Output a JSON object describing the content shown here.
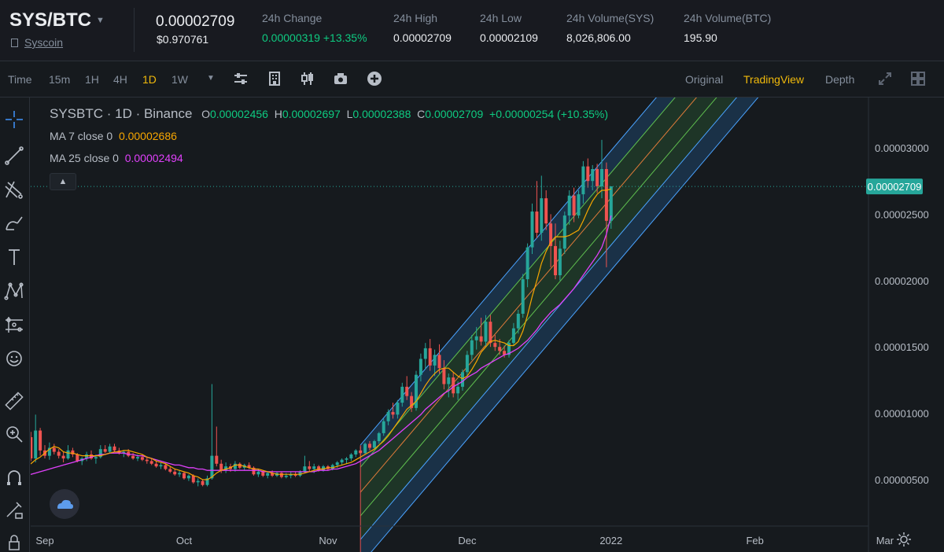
{
  "header": {
    "pair": "SYS/BTC",
    "coin_name": "Syscoin",
    "last_price": "0.00002709",
    "last_price_usd": "$0.970761",
    "stats": [
      {
        "label": "24h Change",
        "value": "0.00000319 +13.35%",
        "color": "green"
      },
      {
        "label": "24h High",
        "value": "0.00002709"
      },
      {
        "label": "24h Low",
        "value": "0.00002109"
      },
      {
        "label": "24h Volume(SYS)",
        "value": "8,026,806.00"
      },
      {
        "label": "24h Volume(BTC)",
        "value": "195.90"
      }
    ]
  },
  "toolbar": {
    "intervals": [
      "Time",
      "15m",
      "1H",
      "4H",
      "1D",
      "1W"
    ],
    "active_interval": "1D",
    "views": [
      "Original",
      "TradingView",
      "Depth"
    ],
    "active_view": "TradingView"
  },
  "legend": {
    "symbol": "SYSBTC · 1D · Binance",
    "o_label": "O",
    "o": "0.00002456",
    "h_label": "H",
    "h": "0.00002697",
    "l_label": "L",
    "l": "0.00002388",
    "c_label": "C",
    "c": "0.00002709",
    "change": "+0.00000254 (+10.35%)",
    "ma7_label": "MA 7 close 0",
    "ma7": "0.00002686",
    "ma25_label": "MA 25 close 0",
    "ma25": "0.00002494"
  },
  "colors": {
    "up": "#26a69a",
    "down": "#ef5350",
    "ma7": "#f7a600",
    "ma25": "#e040fb",
    "bg": "#161a1e",
    "accent": "#f0b90b",
    "current_price": "#26a69a"
  },
  "chart_data": {
    "type": "candlestick",
    "symbol": "SYSBTC",
    "interval": "1D",
    "exchange": "Binance",
    "y_ticks": [
      "0.00003000",
      "0.00002500",
      "0.00002000",
      "0.00001500",
      "0.00001000",
      "0.00000500"
    ],
    "y_tick_values": [
      3e-05,
      2.5e-05,
      2e-05,
      1.5e-05,
      1e-05,
      5e-06
    ],
    "ylim": [
      2.5e-06,
      3.25e-05
    ],
    "x_ticks": [
      "Sep",
      "Oct",
      "Nov",
      "Dec",
      "2022",
      "Feb",
      "Mar"
    ],
    "x_tick_days": [
      0,
      30,
      61,
      91,
      122,
      153,
      181
    ],
    "current_price": 2.709e-05,
    "current_price_label": "0.00002709",
    "candles_start": "2021-09-01",
    "candles": [
      [
        5.5e-06,
        5.8e-06,
        5.3e-06,
        5.6e-06
      ],
      [
        5.6e-06,
        6.1e-06,
        5.5e-06,
        5.9e-06
      ],
      [
        5.9e-06,
        6.2e-06,
        5.7e-06,
        5.8e-06
      ],
      [
        5.8e-06,
        6e-06,
        5.5e-06,
        5.9e-06
      ],
      [
        5.9e-06,
        9.4e-06,
        5.7e-06,
        8.2e-06
      ],
      [
        8.2e-06,
        8.6e-06,
        6.4e-06,
        6.6e-06
      ],
      [
        6.6e-06,
        9.9e-06,
        6.3e-06,
        8.7e-06
      ],
      [
        8.7e-06,
        8.9e-06,
        6.8e-06,
        7.2e-06
      ],
      [
        7.2e-06,
        7.6e-06,
        6.6e-06,
        6.8e-06
      ],
      [
        6.8e-06,
        7.8e-06,
        6.5e-06,
        7.4e-06
      ],
      [
        7.4e-06,
        7.7e-06,
        6.9e-06,
        7.1e-06
      ],
      [
        7.1e-06,
        7.3e-06,
        6.6e-06,
        6.8e-06
      ],
      [
        6.8e-06,
        7.1e-06,
        6.3e-06,
        6.6e-06
      ],
      [
        6.6e-06,
        7.6e-06,
        6.5e-06,
        7.2e-06
      ],
      [
        7.2e-06,
        7.4e-06,
        6.7e-06,
        6.9e-06
      ],
      [
        6.9e-06,
        7e-06,
        6.3e-06,
        6.4e-06
      ],
      [
        6.4e-06,
        6.7e-06,
        6.1e-06,
        6.6e-06
      ],
      [
        6.6e-06,
        7.1e-06,
        6.4e-06,
        6.9e-06
      ],
      [
        6.9e-06,
        7.2e-06,
        6.5e-06,
        6.6e-06
      ],
      [
        6.6e-06,
        6.9e-06,
        6.2e-06,
        6.7e-06
      ],
      [
        6.7e-06,
        7.6e-06,
        6.6e-06,
        7.3e-06
      ],
      [
        7.3e-06,
        7.6e-06,
        7e-06,
        7.1e-06
      ],
      [
        7.1e-06,
        7.7e-06,
        7e-06,
        7.5e-06
      ],
      [
        7.5e-06,
        7.7e-06,
        7.1e-06,
        7.2e-06
      ],
      [
        7.2e-06,
        7.4e-06,
        6.9e-06,
        7e-06
      ],
      [
        7e-06,
        7.2e-06,
        6.7e-06,
        7.1e-06
      ],
      [
        7.1e-06,
        7.3e-06,
        6.7e-06,
        6.8e-06
      ],
      [
        6.8e-06,
        7e-06,
        6.5e-06,
        6.6e-06
      ],
      [
        6.6e-06,
        6.9e-06,
        6.4e-06,
        6.7e-06
      ],
      [
        6.7e-06,
        6.9e-06,
        6.4e-06,
        6.5e-06
      ],
      [
        6.5e-06,
        6.7e-06,
        6.2e-06,
        6.4e-06
      ],
      [
        6.4e-06,
        6.6e-06,
        6.1e-06,
        6.2e-06
      ],
      [
        6.2e-06,
        6.4e-06,
        5.9e-06,
        6e-06
      ],
      [
        6e-06,
        6.3e-06,
        5.8e-06,
        6.1e-06
      ],
      [
        6.1e-06,
        6.2e-06,
        5.7e-06,
        5.8e-06
      ],
      [
        5.8e-06,
        6e-06,
        5.5e-06,
        5.6e-06
      ],
      [
        5.6e-06,
        5.8e-06,
        5.3e-06,
        5.4e-06
      ],
      [
        5.4e-06,
        5.7e-06,
        5.2e-06,
        5.5e-06
      ],
      [
        5.5e-06,
        5.6e-06,
        5e-06,
        5.1e-06
      ],
      [
        5.1e-06,
        5.4e-06,
        4.9e-06,
        5.3e-06
      ],
      [
        5.3e-06,
        5.4e-06,
        4.7e-06,
        4.8e-06
      ],
      [
        4.8e-06,
        5.1e-06,
        4.5e-06,
        4.9e-06
      ],
      [
        4.9e-06,
        5e-06,
        4.5e-06,
        4.6e-06
      ],
      [
        4.6e-06,
        5.3e-06,
        4.5e-06,
        5.1e-06
      ],
      [
        5.1e-06,
        1.22e-05,
        5e-06,
        6.8e-06
      ],
      [
        6.8e-06,
        9e-06,
        6e-06,
        6.2e-06
      ],
      [
        6.2e-06,
        6.5e-06,
        5.5e-06,
        5.7e-06
      ],
      [
        5.7e-06,
        6.3e-06,
        5.5e-06,
        6e-06
      ],
      [
        6e-06,
        6.2e-06,
        5.6e-06,
        5.8e-06
      ],
      [
        5.8e-06,
        6.4e-06,
        5.6e-06,
        6.2e-06
      ],
      [
        6.2e-06,
        6.3e-06,
        5.8e-06,
        5.9e-06
      ],
      [
        5.9e-06,
        6.2e-06,
        5.7e-06,
        6.1e-06
      ],
      [
        6.1e-06,
        6.3e-06,
        5.8e-06,
        5.9e-06
      ],
      [
        5.9e-06,
        6e-06,
        5.3e-06,
        5.4e-06
      ],
      [
        5.4e-06,
        5.8e-06,
        5.2e-06,
        5.6e-06
      ],
      [
        5.6e-06,
        5.7e-06,
        5.2e-06,
        5.3e-06
      ],
      [
        5.3e-06,
        5.6e-06,
        5.1e-06,
        5.5e-06
      ],
      [
        5.5e-06,
        5.7e-06,
        5.2e-06,
        5.3e-06
      ],
      [
        5.3e-06,
        5.6e-06,
        5.2e-06,
        5.5e-06
      ],
      [
        5.5e-06,
        5.6e-06,
        5.1e-06,
        5.2e-06
      ],
      [
        5.2e-06,
        5.5e-06,
        5.1e-06,
        5.3e-06
      ],
      [
        5.3e-06,
        5.6e-06,
        5.1e-06,
        5.4e-06
      ],
      [
        5.4e-06,
        5.6e-06,
        5.2e-06,
        5.3e-06
      ],
      [
        5.3e-06,
        5.7e-06,
        5.2e-06,
        5.6e-06
      ],
      [
        5.6e-06,
        6.8e-06,
        5.5e-06,
        6e-06
      ],
      [
        6e-06,
        6.4e-06,
        5.6e-06,
        5.8e-06
      ],
      [
        5.8e-06,
        6.2e-06,
        5.5e-06,
        6e-06
      ],
      [
        6e-06,
        6.1e-06,
        5.6e-06,
        5.7e-06
      ],
      [
        5.7e-06,
        6.1e-06,
        5.6e-06,
        6e-06
      ],
      [
        6e-06,
        6.1e-06,
        5.7e-06,
        5.8e-06
      ],
      [
        5.8e-06,
        6.2e-06,
        5.7e-06,
        6.1e-06
      ],
      [
        6.1e-06,
        6.4e-06,
        5.9e-06,
        6.3e-06
      ],
      [
        6.3e-06,
        6.6e-06,
        6.1e-06,
        6.5e-06
      ],
      [
        6.5e-06,
        6.7e-06,
        6.2e-06,
        6.6e-06
      ],
      [
        6.6e-06,
        7e-06,
        6.4e-06,
        6.9e-06
      ],
      [
        6.9e-06,
        7.3e-06,
        6.7e-06,
        7.2e-06
      ],
      [
        7.2e-06,
        7.5e-06,
        6.8e-06,
        7e-06
      ],
      [
        7e-06,
        7.8e-06,
        6.9e-06,
        7.7e-06
      ],
      [
        7.7e-06,
        7.9e-06,
        7.2e-06,
        7.4e-06
      ],
      [
        7.4e-06,
        8e-06,
        7.3e-06,
        7.9e-06
      ],
      [
        7.9e-06,
        8.6e-06,
        7.7e-06,
        8.5e-06
      ],
      [
        8.5e-06,
        9.6e-06,
        8.3e-06,
        9.4e-06
      ],
      [
        9.4e-06,
        1.03e-05,
        9.1e-06,
        1.01e-05
      ],
      [
        1.01e-05,
        1.08e-05,
        9.6e-06,
        9.9e-06
      ],
      [
        9.9e-06,
        1.1e-05,
        9.6e-06,
        1.08e-05
      ],
      [
        1.08e-05,
        1.23e-05,
        1.05e-05,
        1.2e-05
      ],
      [
        1.2e-05,
        1.28e-05,
        1.1e-05,
        1.13e-05
      ],
      [
        1.13e-05,
        1.16e-05,
        1.01e-05,
        1.04e-05
      ],
      [
        1.04e-05,
        1.32e-05,
        1.02e-05,
        1.29e-05
      ],
      [
        1.29e-05,
        1.45e-05,
        1.24e-05,
        1.41e-05
      ],
      [
        1.41e-05,
        1.53e-05,
        1.33e-05,
        1.49e-05
      ],
      [
        1.49e-05,
        1.56e-05,
        1.32e-05,
        1.36e-05
      ],
      [
        1.36e-05,
        1.48e-05,
        1.28e-05,
        1.44e-05
      ],
      [
        1.44e-05,
        1.52e-05,
        1.3e-05,
        1.34e-05
      ],
      [
        1.34e-05,
        1.4e-05,
        1.18e-05,
        1.22e-05
      ],
      [
        1.22e-05,
        1.3e-05,
        1.12e-05,
        1.27e-05
      ],
      [
        1.27e-05,
        1.31e-05,
        1.12e-05,
        1.15e-05
      ],
      [
        1.15e-05,
        1.24e-05,
        1.1e-05,
        1.2e-05
      ],
      [
        1.2e-05,
        1.33e-05,
        1.17e-05,
        1.31e-05
      ],
      [
        1.31e-05,
        1.47e-05,
        1.28e-05,
        1.44e-05
      ],
      [
        1.44e-05,
        1.59e-05,
        1.4e-05,
        1.55e-05
      ],
      [
        1.55e-05,
        1.65e-05,
        1.48e-05,
        1.58e-05
      ],
      [
        1.58e-05,
        1.72e-05,
        1.51e-05,
        1.54e-05
      ],
      [
        1.54e-05,
        1.74e-05,
        1.5e-05,
        1.69e-05
      ],
      [
        1.69e-05,
        1.74e-05,
        1.5e-05,
        1.53e-05
      ],
      [
        1.53e-05,
        1.59e-05,
        1.47e-05,
        1.5e-05
      ],
      [
        1.5e-05,
        1.56e-05,
        1.44e-05,
        1.47e-05
      ],
      [
        1.47e-05,
        1.51e-05,
        1.42e-05,
        1.44e-05
      ],
      [
        1.44e-05,
        1.55e-05,
        1.42e-05,
        1.53e-05
      ],
      [
        1.53e-05,
        1.68e-05,
        1.51e-05,
        1.64e-05
      ],
      [
        1.64e-05,
        1.78e-05,
        1.6e-05,
        1.75e-05
      ],
      [
        1.75e-05,
        2.05e-05,
        1.72e-05,
        2.01e-05
      ],
      [
        2.01e-05,
        2.28e-05,
        1.95e-05,
        2.25e-05
      ],
      [
        2.25e-05,
        2.58e-05,
        2.2e-05,
        2.52e-05
      ],
      [
        2.52e-05,
        2.75e-05,
        2.32e-05,
        2.36e-05
      ],
      [
        2.36e-05,
        2.79e-05,
        2.3e-05,
        2.62e-05
      ],
      [
        2.62e-05,
        2.68e-05,
        2.38e-05,
        2.43e-05
      ],
      [
        2.43e-05,
        2.5e-05,
        2.1e-05,
        2.26e-05
      ],
      [
        2.26e-05,
        2.43e-05,
        2.01e-05,
        2.04e-05
      ],
      [
        2.04e-05,
        2.3e-05,
        2e-05,
        2.24e-05
      ],
      [
        2.24e-05,
        2.52e-05,
        2.2e-05,
        2.49e-05
      ],
      [
        2.49e-05,
        2.68e-05,
        2.42e-05,
        2.64e-05
      ],
      [
        2.64e-05,
        2.7e-05,
        2.44e-05,
        2.49e-05
      ],
      [
        2.49e-05,
        2.68e-05,
        2.47e-05,
        2.65e-05
      ],
      [
        2.65e-05,
        2.9e-05,
        2.58e-05,
        2.86e-05
      ],
      [
        2.86e-05,
        2.92e-05,
        2.7e-05,
        2.75e-05
      ],
      [
        2.75e-05,
        2.87e-05,
        2.68e-05,
        2.84e-05
      ],
      [
        2.84e-05,
        2.88e-05,
        2.66e-05,
        2.71e-05
      ],
      [
        2.71e-05,
        3.06e-05,
        2.62e-05,
        2.84e-05
      ],
      [
        2.84e-05,
        2.89e-05,
        2.1e-05,
        2.45e-05
      ],
      [
        2.45e-05,
        2.71e-05,
        2.39e-05,
        2.71e-05
      ]
    ],
    "ma7": [
      5.7e-06,
      5.8e-06,
      5.8e-06,
      5.8e-06,
      6.1e-06,
      6.2e-06,
      6.5e-06,
      6.7e-06,
      7e-06,
      7.3e-06,
      7.5e-06,
      7.4e-06,
      7.1e-06,
      7e-06,
      7e-06,
      6.9e-06,
      6.8e-06,
      6.8e-06,
      6.8e-06,
      6.8e-06,
      6.8e-06,
      6.9e-06,
      7e-06,
      7.1e-06,
      7.1e-06,
      7.2e-06,
      7.2e-06,
      7.1e-06,
      7e-06,
      6.9e-06,
      6.7e-06,
      6.6e-06,
      6.4e-06,
      6.3e-06,
      6.2e-06,
      6e-06,
      5.8e-06,
      5.7e-06,
      5.6e-06,
      5.5e-06,
      5.3e-06,
      5.2e-06,
      5e-06,
      5e-06,
      5.2e-06,
      5.5e-06,
      5.7e-06,
      5.8e-06,
      5.9e-06,
      6.1e-06,
      6.1e-06,
      6e-06,
      5.9e-06,
      5.8e-06,
      5.8e-06,
      5.7e-06,
      5.6e-06,
      5.5e-06,
      5.4e-06,
      5.4e-06,
      5.4e-06,
      5.4e-06,
      5.4e-06,
      5.4e-06,
      5.5e-06,
      5.6e-06,
      5.7e-06,
      5.8e-06,
      5.8e-06,
      5.9e-06,
      5.9e-06,
      6e-06,
      6.1e-06,
      6.2e-06,
      6.3e-06,
      6.5e-06,
      6.7e-06,
      6.9e-06,
      7.1e-06,
      7.3e-06,
      7.6e-06,
      7.9e-06,
      8.3e-06,
      8.8e-06,
      9.3e-06,
      9.8e-06,
      1.03e-05,
      1.06e-05,
      1.09e-05,
      1.15e-05,
      1.21e-05,
      1.26e-05,
      1.3e-05,
      1.33e-05,
      1.34e-05,
      1.34e-05,
      1.31e-05,
      1.28e-05,
      1.26e-05,
      1.28e-05,
      1.33e-05,
      1.39e-05,
      1.46e-05,
      1.5e-05,
      1.54e-05,
      1.55e-05,
      1.54e-05,
      1.53e-05,
      1.51e-05,
      1.51e-05,
      1.54e-05,
      1.62e-05,
      1.74e-05,
      1.88e-05,
      2e-05,
      2.13e-05,
      2.22e-05,
      2.29e-05,
      2.33e-05,
      2.33e-05,
      2.33e-05,
      2.34e-05,
      2.36e-05,
      2.38e-05,
      2.45e-05,
      2.53e-05,
      2.6e-05,
      2.65e-05,
      2.68e-05,
      2.68e-05,
      2.69e-05
    ],
    "ma25": [
      4.9e-06,
      5e-06,
      5.1e-06,
      5.2e-06,
      5.3e-06,
      5.4e-06,
      5.5e-06,
      5.6e-06,
      5.7e-06,
      5.8e-06,
      5.9e-06,
      6e-06,
      6.1e-06,
      6.2e-06,
      6.3e-06,
      6.4e-06,
      6.5e-06,
      6.6e-06,
      6.7e-06,
      6.8e-06,
      6.9e-06,
      6.9e-06,
      7e-06,
      7e-06,
      7e-06,
      7e-06,
      6.9e-06,
      6.9e-06,
      6.8e-06,
      6.8e-06,
      6.7e-06,
      6.6e-06,
      6.5e-06,
      6.4e-06,
      6.3e-06,
      6.2e-06,
      6.1e-06,
      6.1e-06,
      6e-06,
      5.9e-06,
      5.9e-06,
      5.8e-06,
      5.8e-06,
      5.7e-06,
      5.7e-06,
      5.7e-06,
      5.7e-06,
      5.7e-06,
      5.7e-06,
      5.7e-06,
      5.7e-06,
      5.7e-06,
      5.7e-06,
      5.7e-06,
      5.7e-06,
      5.6e-06,
      5.6e-06,
      5.6e-06,
      5.6e-06,
      5.6e-06,
      5.6e-06,
      5.6e-06,
      5.6e-06,
      5.6e-06,
      5.6e-06,
      5.6e-06,
      5.6e-06,
      5.7e-06,
      5.7e-06,
      5.7e-06,
      5.8e-06,
      5.8e-06,
      5.9e-06,
      6e-06,
      6.1e-06,
      6.2e-06,
      6.4e-06,
      6.6e-06,
      6.8e-06,
      7e-06,
      7.2e-06,
      7.5e-06,
      7.8e-06,
      8.1e-06,
      8.4e-06,
      8.7e-06,
      9e-06,
      9.3e-06,
      9.6e-06,
      9.9e-06,
      1.03e-05,
      1.06e-05,
      1.09e-05,
      1.12e-05,
      1.15e-05,
      1.17e-05,
      1.2e-05,
      1.22e-05,
      1.24e-05,
      1.27e-05,
      1.29e-05,
      1.31e-05,
      1.34e-05,
      1.36e-05,
      1.38e-05,
      1.4e-05,
      1.42e-05,
      1.44e-05,
      1.45e-05,
      1.47e-05,
      1.49e-05,
      1.52e-05,
      1.55e-05,
      1.59e-05,
      1.63e-05,
      1.68e-05,
      1.72e-05,
      1.76e-05,
      1.79e-05,
      1.82e-05,
      1.86e-05,
      1.9e-05,
      1.94e-05,
      1.99e-05,
      2.04e-05,
      2.09e-05,
      2.14e-05,
      2.19e-05,
      2.25e-05,
      2.35e-05,
      2.49e-05
    ]
  }
}
